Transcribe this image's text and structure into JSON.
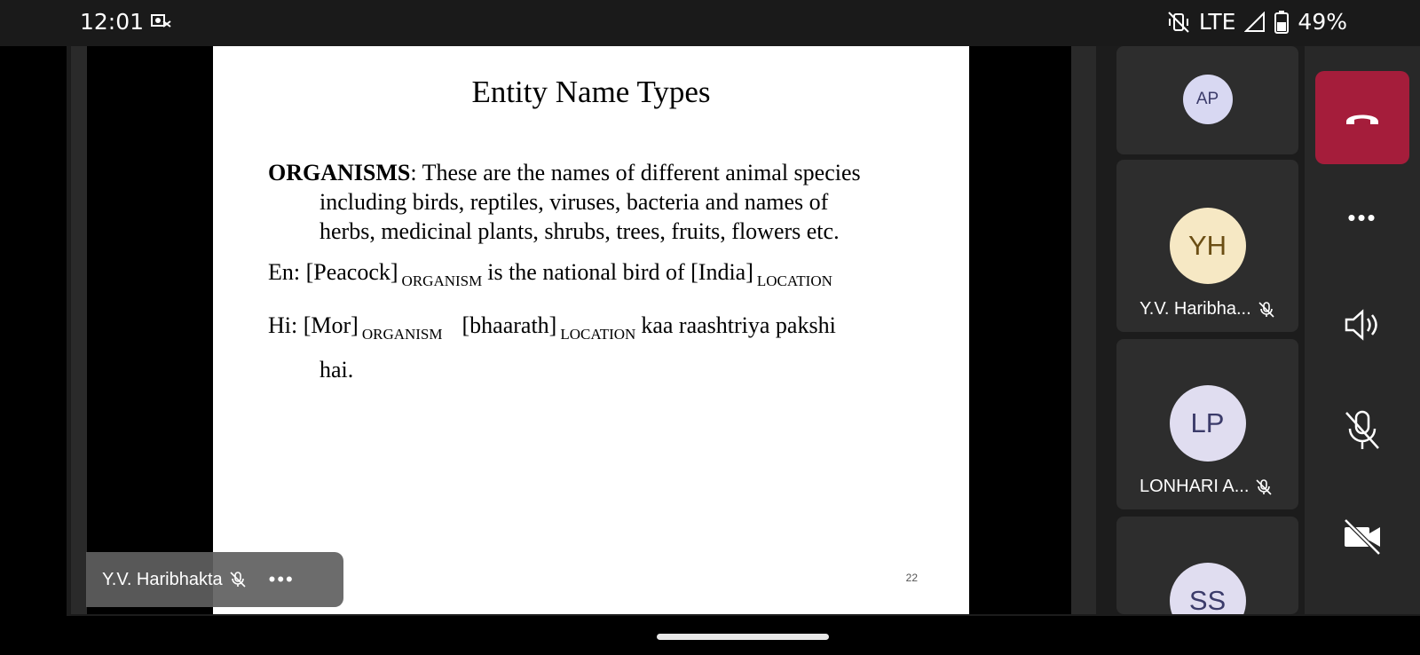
{
  "status_bar": {
    "time": "12:01",
    "network": "LTE",
    "battery": "49%",
    "icons": [
      "notification-icon",
      "vibrate-off-icon",
      "signal-icon",
      "battery-icon"
    ]
  },
  "slide": {
    "title": "Entity Name Types",
    "organisms_term": "ORGANISMS",
    "organisms_line1": ": These are the names of different animal species",
    "organisms_line2": "including birds, reptiles, viruses, bacteria and names of",
    "organisms_line3": "herbs, medicinal plants, shrubs, trees, fruits, flowers etc.",
    "en_prefix": "En: [Peacock]",
    "en_tag1": "ORGANISM",
    "en_mid": "is the national bird of [India]",
    "en_tag2": "LOCATION",
    "hi_prefix": "Hi: [Mor]",
    "hi_tag1": "ORGANISM",
    "hi_mid": "[bhaarath]",
    "hi_tag2": "LOCATION",
    "hi_suffix": "kaa raashtriya pakshi",
    "hi_line2": "hai.",
    "page_number": "22"
  },
  "presenter": {
    "name": "Y.V. Haribhakta",
    "more": "•••"
  },
  "participants": [
    {
      "initials": "AP",
      "name": ""
    },
    {
      "initials": "YH",
      "name": "Y.V. Haribha..."
    },
    {
      "initials": "LP",
      "name": "LONHARI A..."
    },
    {
      "initials": "SS",
      "name": ""
    }
  ],
  "controls": {
    "more": "•••",
    "icons": [
      "hang-up-icon",
      "more-options-icon",
      "speaker-icon",
      "mic-off-icon",
      "camera-off-icon"
    ]
  },
  "colors": {
    "hangup": "#a51d3b",
    "avatar_ap": "#d8d8f2",
    "avatar_yh": "#f6e8c4",
    "avatar_lp": "#e0ddf0"
  }
}
